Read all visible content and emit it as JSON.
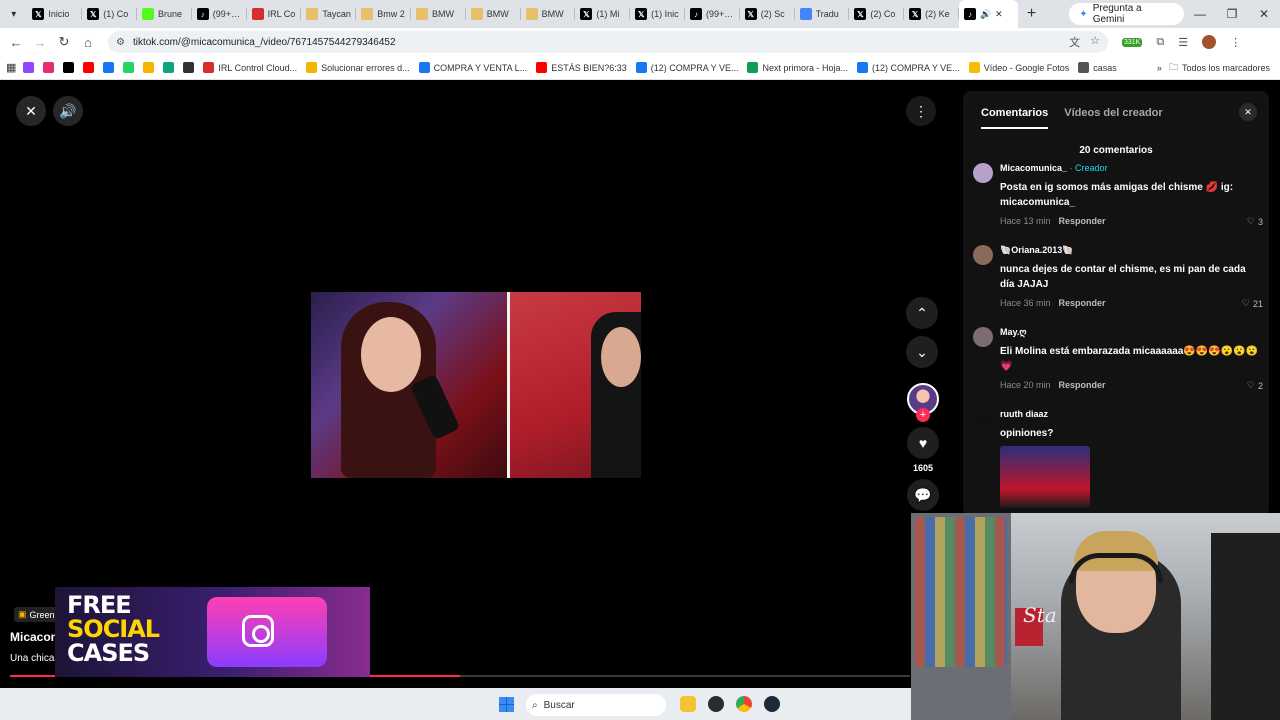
{
  "browser": {
    "tabs": [
      {
        "label": "Inicio",
        "icon": "x-icon",
        "color": "#000000"
      },
      {
        "label": "(1) Co",
        "icon": "x-icon",
        "color": "#000000"
      },
      {
        "label": "Brune",
        "icon": "kick-icon",
        "color": "#53fc18"
      },
      {
        "label": "(99+) T",
        "icon": "tiktok-icon",
        "color": "#000000"
      },
      {
        "label": "IRL Co",
        "icon": "irl-icon",
        "color": "#d32f2f"
      },
      {
        "label": "Taycan",
        "icon": "taycan-icon",
        "color": "#e8c06a"
      },
      {
        "label": "Bmw 2",
        "icon": "bmw-icon",
        "color": "#e8c06a"
      },
      {
        "label": "BMW",
        "icon": "bmw-icon",
        "color": "#e8c06a"
      },
      {
        "label": "BMW",
        "icon": "bmw-icon",
        "color": "#e8c06a"
      },
      {
        "label": "BMW",
        "icon": "bmw-icon",
        "color": "#e8c06a"
      },
      {
        "label": "(1) Mi",
        "icon": "x-icon",
        "color": "#000000"
      },
      {
        "label": "(1) Inic",
        "icon": "x-icon",
        "color": "#000000"
      },
      {
        "label": "(99+) T",
        "icon": "tiktok-icon",
        "color": "#000000"
      },
      {
        "label": "(2) Sc",
        "icon": "x-icon",
        "color": "#000000"
      },
      {
        "label": "Tradu",
        "icon": "translate-icon",
        "color": "#4285f4"
      },
      {
        "label": "(2) Co",
        "icon": "x-icon",
        "color": "#000000"
      },
      {
        "label": "(2) Ke",
        "icon": "x-icon",
        "color": "#000000"
      }
    ],
    "active_tab_icon": "tiktok-icon",
    "gemini_label": "Pregunta a Gemini",
    "url": "tiktok.com/@micacomunica_/video/7671457544279346452",
    "extension_badge": "331K",
    "bookmarks": [
      {
        "label": "",
        "color": "#9146ff"
      },
      {
        "label": "",
        "color": "#e1306c"
      },
      {
        "label": "",
        "color": "#000000"
      },
      {
        "label": "",
        "color": "#ff0000"
      },
      {
        "label": "",
        "color": "#1877f2"
      },
      {
        "label": "",
        "color": "#25d366"
      },
      {
        "label": "",
        "color": "#f4b400"
      },
      {
        "label": "",
        "color": "#10a37f"
      },
      {
        "label": "",
        "color": "#333333"
      },
      {
        "label": "IRL Control Cloud...",
        "color": "#d32f2f"
      },
      {
        "label": "Solucionar errores d...",
        "color": "#f4b400"
      },
      {
        "label": "COMPRA Y VENTA L...",
        "color": "#1877f2"
      },
      {
        "label": "ESTÁS BIEN?6:33",
        "color": "#ff0000"
      },
      {
        "label": "(12) COMPRA Y VE...",
        "color": "#1877f2"
      },
      {
        "label": "Next primora - Hoja...",
        "color": "#0f9d58"
      },
      {
        "label": "(12) COMPRA Y VE...",
        "color": "#1877f2"
      },
      {
        "label": "Vídeo - Google Fotos",
        "color": "#fbbc04"
      },
      {
        "label": "casas",
        "color": "#555555"
      }
    ],
    "bookmarks_folder": "Todos los marcadores"
  },
  "player": {
    "like_count": "1605",
    "music_tag": "Green S",
    "author": "Micacom",
    "caption": "Una chica",
    "progress": 0.5
  },
  "ad": {
    "line1": "FREE",
    "line2": "SOCIAL",
    "line3": "CASES"
  },
  "webcam": {
    "shirt_text": "Sta"
  },
  "comments_panel": {
    "tab_comments": "Comentarios",
    "tab_creator_videos": "Vídeos del creador",
    "count_label": "20 comentarios",
    "items": [
      {
        "user": "Micacomunica_",
        "creator_badge": "· Creador",
        "text": "Posta en ig somos más amigas del chisme 💋 ig: micacomunica_",
        "time": "Hace 13 min",
        "reply": "Responder",
        "likes": "3"
      },
      {
        "user": "🐚Oriana.2013🐚",
        "creator_badge": "",
        "text": "nunca dejes de contar el chisme, es mi pan de cada día JAJAJ",
        "time": "Hace 36 min",
        "reply": "Responder",
        "likes": "21"
      },
      {
        "user": "May.ღ",
        "creator_badge": "",
        "text": "Eli Molina está embarazada micaaaaaa😍😍😍😮😮😮💗",
        "time": "Hace 20 min",
        "reply": "Responder",
        "likes": "2"
      },
      {
        "user": "ruuth diaaz",
        "creator_badge": "",
        "text": "opiniones?",
        "time": "",
        "reply": "",
        "likes": ""
      }
    ]
  },
  "taskbar": {
    "search_placeholder": "Buscar"
  }
}
